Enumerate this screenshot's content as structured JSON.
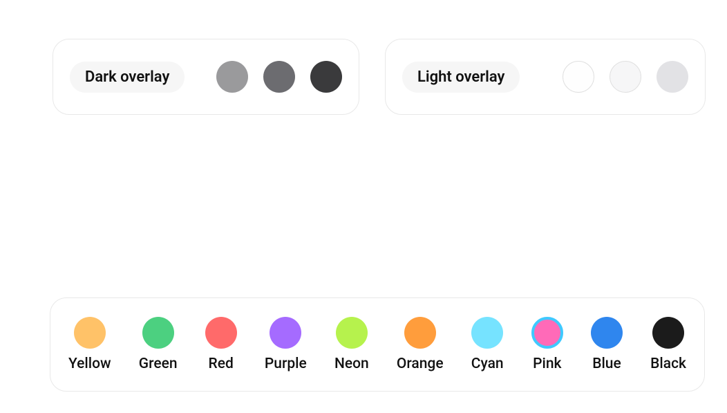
{
  "overlays": {
    "dark": {
      "label": "Dark overlay",
      "swatches": [
        {
          "name": "dark-overlay-light",
          "color": "#9a9a9c"
        },
        {
          "name": "dark-overlay-medium",
          "color": "#6c6c70"
        },
        {
          "name": "dark-overlay-full",
          "color": "#3a3a3c"
        }
      ]
    },
    "light": {
      "label": "Light overlay",
      "swatches": [
        {
          "name": "light-overlay-light",
          "color": "#fefefe",
          "outlined": true
        },
        {
          "name": "light-overlay-medium",
          "color": "#f6f6f7",
          "outlined": true
        },
        {
          "name": "light-overlay-full",
          "color": "#e2e2e5"
        }
      ]
    }
  },
  "palette": [
    {
      "name": "Yellow",
      "color": "#ffc268"
    },
    {
      "name": "Green",
      "color": "#4cd080"
    },
    {
      "name": "Red",
      "color": "#ff6a6a"
    },
    {
      "name": "Purple",
      "color": "#a56bff"
    },
    {
      "name": "Neon",
      "color": "#b6f24d"
    },
    {
      "name": "Orange",
      "color": "#ff9d3c"
    },
    {
      "name": "Cyan",
      "color": "#76e3ff"
    },
    {
      "name": "Pink",
      "color": "#ff6ab8",
      "ring": "#3fc9ff"
    },
    {
      "name": "Blue",
      "color": "#2f86ee"
    },
    {
      "name": "Black",
      "color": "#1b1b1b"
    }
  ]
}
